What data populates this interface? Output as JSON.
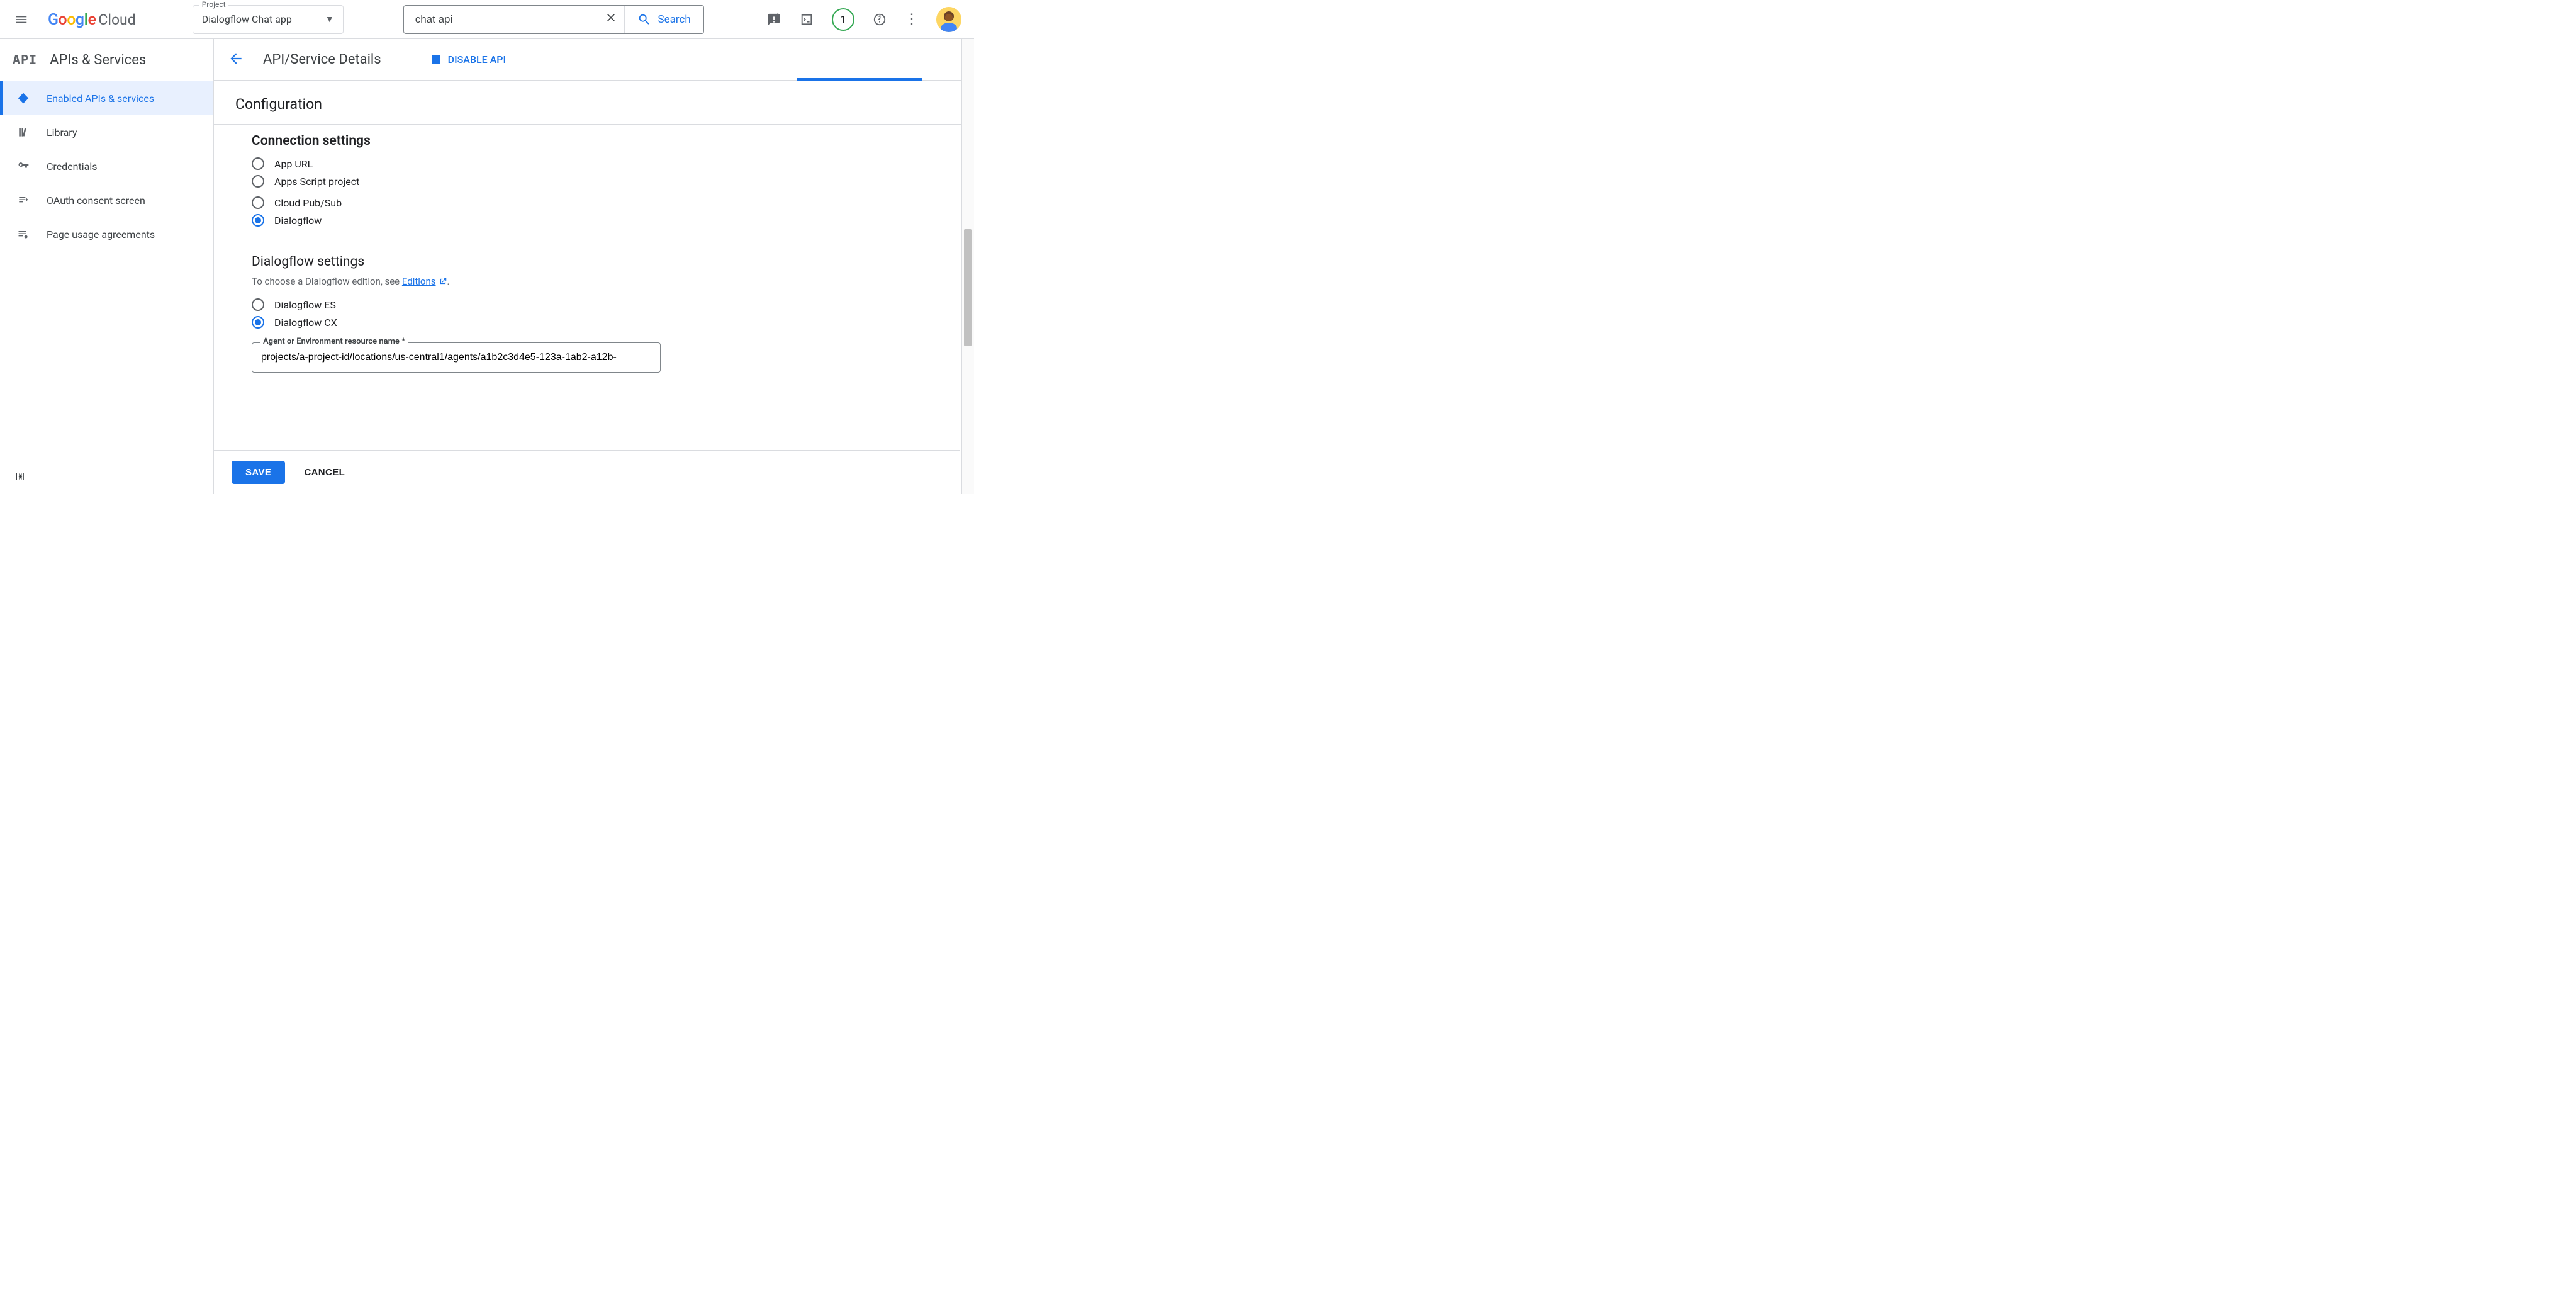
{
  "header": {
    "logo_google": "Google",
    "logo_cloud": "Cloud",
    "project_label": "Project",
    "project_value": "Dialogflow Chat app",
    "search_value": "chat api",
    "search_button": "Search",
    "badge_count": "1"
  },
  "leftnav": {
    "brand_icon": "API",
    "title": "APIs & Services",
    "items": [
      {
        "label": "Enabled APIs & services",
        "active": true
      },
      {
        "label": "Library",
        "active": false
      },
      {
        "label": "Credentials",
        "active": false
      },
      {
        "label": "OAuth consent screen",
        "active": false
      },
      {
        "label": "Page usage agreements",
        "active": false
      }
    ]
  },
  "main": {
    "page_title": "API/Service Details",
    "disable_api": "DISABLE API",
    "section_title": "Configuration",
    "connection": {
      "heading": "Connection settings",
      "options": [
        "App URL",
        "Apps Script project",
        "Cloud Pub/Sub",
        "Dialogflow"
      ],
      "selected": "Dialogflow"
    },
    "dialogflow": {
      "heading": "Dialogflow settings",
      "helper_prefix": "To choose a Dialogflow edition, see ",
      "helper_link": "Editions",
      "helper_suffix": ".",
      "options": [
        "Dialogflow ES",
        "Dialogflow CX"
      ],
      "selected": "Dialogflow CX",
      "resource_label": "Agent or Environment resource name *",
      "resource_value": "projects/a-project-id/locations/us-central1/agents/a1b2c3d4e5-123a-1ab2-a12b-"
    },
    "footer": {
      "save": "SAVE",
      "cancel": "CANCEL"
    }
  }
}
